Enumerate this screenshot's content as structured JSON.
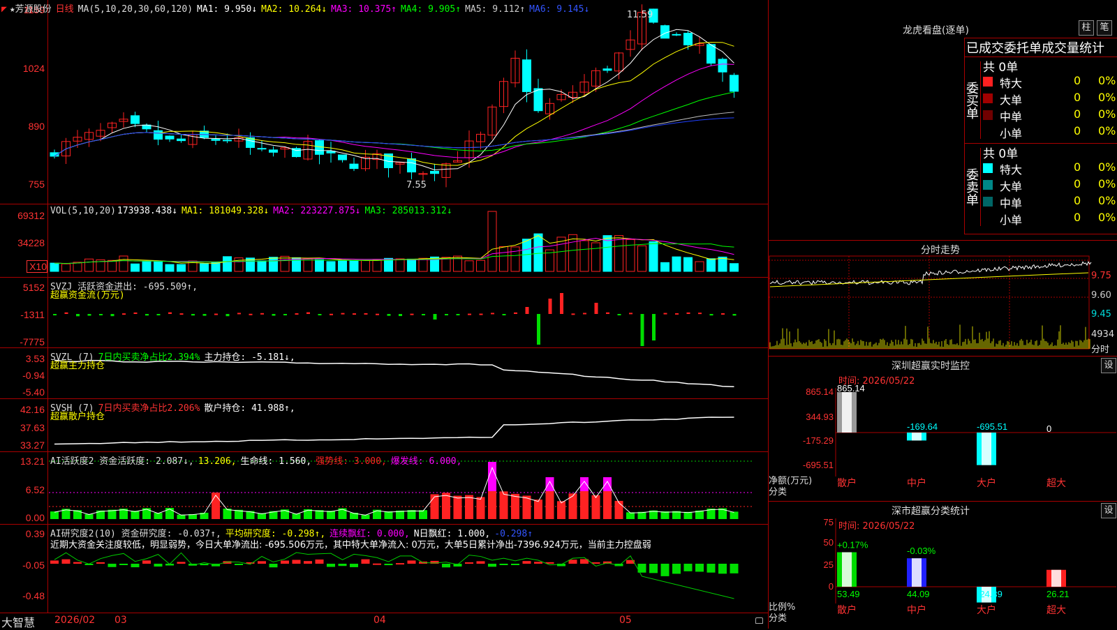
{
  "colors": {
    "up": "#ff2222",
    "down": "#00ffff",
    "ma1": "#ffffff",
    "ma2": "#ffff00",
    "ma3": "#ff00ff",
    "ma4": "#00ff00",
    "ma5": "#c0c0c0",
    "ma6": "#2040ff"
  },
  "header": {
    "corner": "◤",
    "title": "★芳源股份",
    "period": "日线",
    "ma_label": "MA(5,10,20,30,60,120)",
    "ma1": "MA1: 9.950↓",
    "ma2": "MA2: 10.264↓",
    "ma3": "MA3: 10.375↑",
    "ma4": "MA4: 9.905↑",
    "ma5": "MA5: 9.112↑",
    "ma6": "MA6: 9.145↓",
    "hi_mark": "11.59",
    "lo_mark": "7.55"
  },
  "price_axis": [
    "1159",
    "1024",
    "890",
    "755"
  ],
  "vol": {
    "label": "VOL(5,10,20)",
    "value": "173938.438↓",
    "ma1": "MA1: 181049.328↓",
    "ma2": "MA2: 223227.875↓",
    "ma3": "MA3: 285013.312↓",
    "axis": [
      "69312",
      "34228"
    ],
    "unit": "X10"
  },
  "svzj": {
    "label": "SVZJ 活跃资金进出: -695.509↑,",
    "sub": "超赢资金流(万元)",
    "axis": [
      "5152",
      "-1311",
      "-7775"
    ]
  },
  "svzl": {
    "label": "SVZL (7)",
    "ratio": "7日内买卖净占比2.394%",
    "main": "主力持仓: -5.181↓,",
    "sub": "超赢主力持仓",
    "axis": [
      "3.53",
      "-0.94",
      "-5.40"
    ]
  },
  "svsh": {
    "label": "SVSH (7)",
    "ratio": "7日内买卖净占比2.206%",
    "main": "散户持仓: 41.988↑,",
    "sub": "超赢散户持仓",
    "axis": [
      "42.16",
      "37.63",
      "33.27"
    ]
  },
  "ai2": {
    "label": "AI活跃度2 资金活跃度: 2.087↓,",
    "v2": "13.206,",
    "v3": "生命线: 1.560,",
    "v4": "强势线: 3.000,",
    "v5": "爆发线: 6.000,",
    "axis": [
      "13.21",
      "6.52",
      "0.00"
    ]
  },
  "ai3": {
    "label": "AI研究度2(10) 资金研究度: -0.037↑,",
    "v2": "平均研究度: -0.298↑,",
    "v3": "连续飘红: 0.000,",
    "v4": "N日飘红: 1.000,",
    "v5": "-0.298↑",
    "note": "近期大资金关注度较低，明显弱势，今日大单净流出: -695.506万元，其中特大单净流入: 0万元，大单5日累计净出-7396.924万元，当前主力控盘弱",
    "axis": [
      "0.39",
      "-0.05",
      "-0.48"
    ]
  },
  "footer": {
    "brand": "大智慧",
    "d1": "2026/02",
    "d2": "03",
    "d3": "04",
    "d4": "05"
  },
  "dragon": {
    "title": "龙虎看盘(逐单)",
    "btn1": "柱",
    "btn2": "笔",
    "head": "已成交委托单成交量统计",
    "buy": {
      "side": "委买单",
      "total": "共 0单",
      "rows": [
        {
          "name": "特大",
          "v": "0",
          "p": "0%",
          "c": "#ff2020"
        },
        {
          "name": "大单",
          "v": "0",
          "p": "0%",
          "c": "#a00000"
        },
        {
          "name": "中单",
          "v": "0",
          "p": "0%",
          "c": "#700000"
        },
        {
          "name": "小单",
          "v": "0",
          "p": "0%",
          "c": ""
        }
      ]
    },
    "sell": {
      "side": "委卖单",
      "total": "共 0单",
      "rows": [
        {
          "name": "特大",
          "v": "0",
          "p": "0%",
          "c": "#00ffff"
        },
        {
          "name": "大单",
          "v": "0",
          "p": "0%",
          "c": "#008888"
        },
        {
          "name": "中单",
          "v": "0",
          "p": "0%",
          "c": "#006666"
        },
        {
          "name": "小单",
          "v": "0",
          "p": "0%",
          "c": ""
        }
      ]
    }
  },
  "intraday": {
    "title": "分时走势",
    "axis": [
      "9.75",
      "9.60",
      "9.45"
    ],
    "vol": "4934",
    "unit": "分时"
  },
  "monitor": {
    "title": "深圳超赢实时监控",
    "btn": "设",
    "time": "时间: 2026/05/22",
    "axis": [
      "865.14",
      "344.93",
      "-175.29",
      "-695.51"
    ],
    "unit1": "净额(万元)",
    "unit2": "分类",
    "bars": [
      {
        "cat": "散户",
        "val": 865.14,
        "label": "865.14"
      },
      {
        "cat": "中户",
        "val": -169.64,
        "label": "-169.64"
      },
      {
        "cat": "大户",
        "val": -695.51,
        "label": "-695.51"
      },
      {
        "cat": "超大",
        "val": 0,
        "label": "0"
      }
    ]
  },
  "classify": {
    "title": "深市超赢分类统计",
    "btn": "设",
    "time": "时间: 2026/05/22",
    "axis": [
      "75",
      "50",
      "25",
      "0"
    ],
    "unit1": "比例%",
    "unit2": "分类",
    "bars": [
      {
        "cat": "散户",
        "val": 53.49,
        "label": "53.49",
        "chg": "+0.17%",
        "color": "#00dd00"
      },
      {
        "cat": "中户",
        "val": 44.09,
        "label": "44.09",
        "chg": "-0.03%",
        "color": "#2020ff"
      },
      {
        "cat": "大户",
        "val": -24.39,
        "label": "-24.39",
        "chg": "",
        "color": "#00ffff"
      },
      {
        "cat": "超大",
        "val": 26.21,
        "label": "26.21",
        "chg": "",
        "color": "#ff2020"
      }
    ]
  }
}
